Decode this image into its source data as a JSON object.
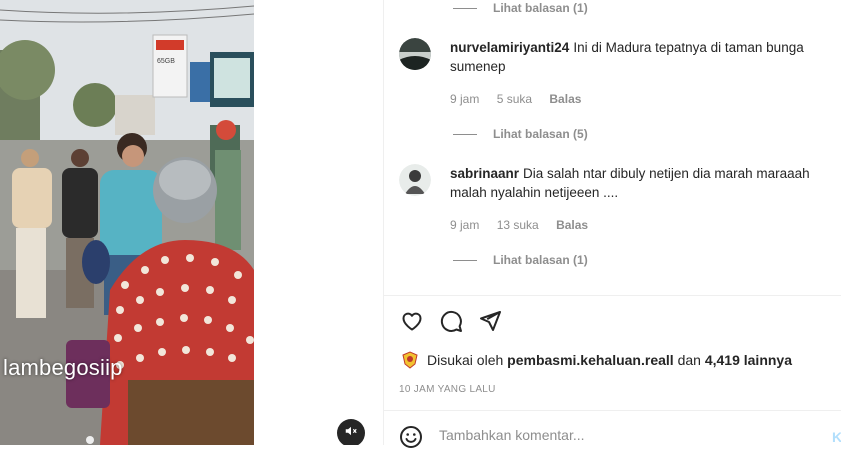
{
  "media": {
    "watermark": "lambegosiip",
    "mute_icon": "speaker-muted-icon",
    "billboard_text": "65GB"
  },
  "replies_top": {
    "label": "Lihat balasan (1)"
  },
  "comments": [
    {
      "username": "nurvelamiriyanti24",
      "text": "Ini di Madura tepatnya di taman bunga sumenep",
      "time": "9 jam",
      "likes": "5 suka",
      "reply": "Balas",
      "view_replies": "Lihat balasan (5)"
    },
    {
      "username": "sabrinaanr",
      "text": "Dia salah ntar dibuly netijen dia marah maraaah malah nyalahin netijeeen ....",
      "time": "9 jam",
      "likes": "13 suka",
      "reply": "Balas",
      "view_replies": "Lihat balasan (1)"
    }
  ],
  "actions": {
    "like_icon": "heart-icon",
    "comment_icon": "comment-icon",
    "share_icon": "send-icon"
  },
  "likes": {
    "prefix": "Disukai oleh",
    "user": "pembasmi.kehaluan.reall",
    "connector": "dan",
    "count": "4,419 lainnya"
  },
  "timestamp": "10 JAM YANG LALU",
  "comment_box": {
    "placeholder": "Tambahkan komentar...",
    "post_label": "K"
  },
  "colors": {
    "text": "#262626",
    "secondary": "#8e8e8e",
    "divider": "#efefef",
    "post_disabled": "#b2dffc"
  }
}
